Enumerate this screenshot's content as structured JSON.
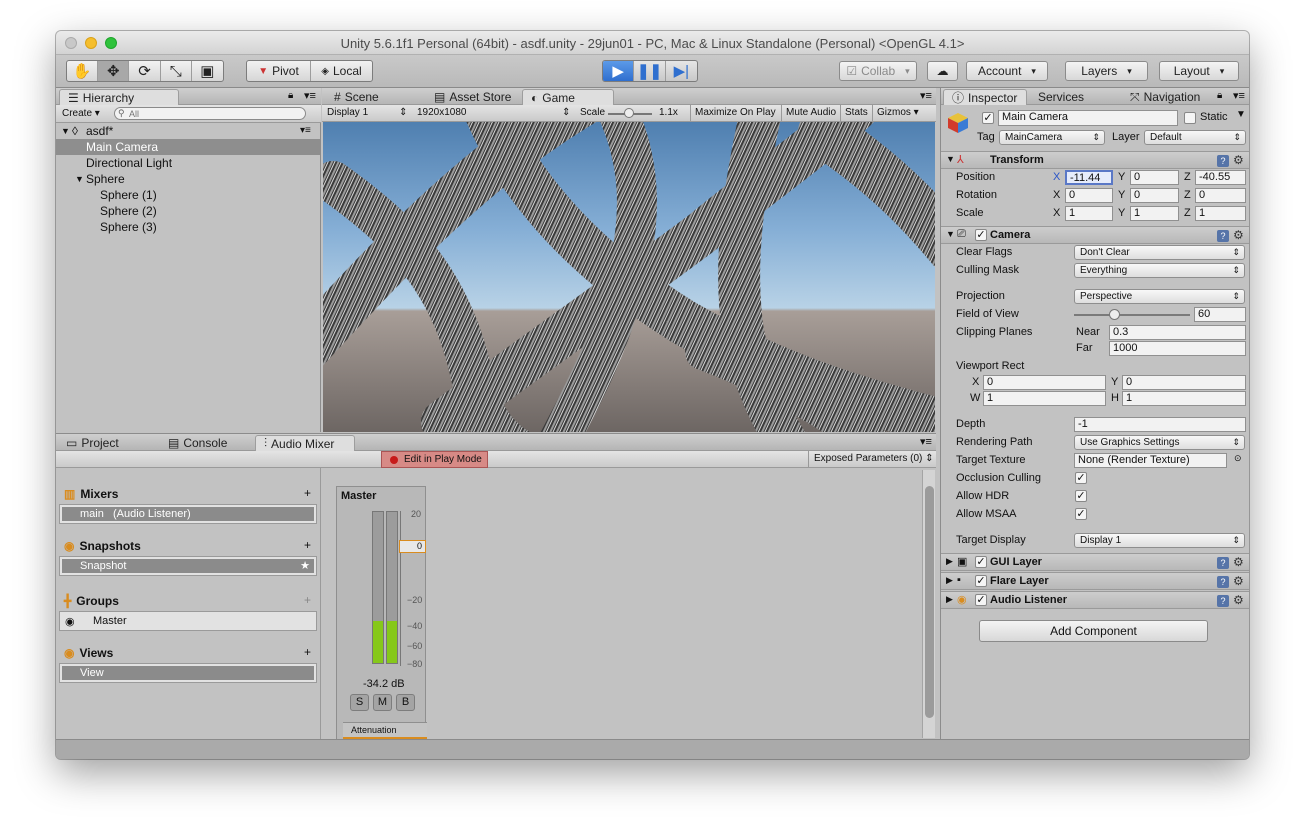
{
  "window": {
    "title": "Unity 5.6.1f1 Personal (64bit) - asdf.unity - 29jun01 - PC, Mac & Linux Standalone (Personal) <OpenGL 4.1>"
  },
  "toolbar": {
    "pivot": "Pivot",
    "local": "Local",
    "collab": "Collab",
    "account": "Account",
    "layers": "Layers",
    "layout": "Layout"
  },
  "hierarchy": {
    "tab": "Hierarchy",
    "create": "Create",
    "search_placeholder": "All",
    "scene": "asdf*",
    "items": [
      "Main Camera",
      "Directional Light",
      "Sphere",
      "Sphere (1)",
      "Sphere (2)",
      "Sphere (3)"
    ]
  },
  "center_tabs": {
    "scene": "Scene",
    "asset_store": "Asset Store",
    "game": "Game"
  },
  "game_bar": {
    "display": "Display 1",
    "resolution": "1920x1080",
    "scale_label": "Scale",
    "scale_value": "1.1x",
    "maximize": "Maximize On Play",
    "mute": "Mute Audio",
    "stats": "Stats",
    "gizmos": "Gizmos"
  },
  "bottom_tabs": {
    "project": "Project",
    "console": "Console",
    "audio_mixer": "Audio Mixer"
  },
  "mixer": {
    "edit_play": "Edit in Play Mode",
    "exposed": "Exposed Parameters (0)",
    "mixers_title": "Mixers",
    "mixer_item": "main",
    "mixer_item_sub": "(Audio Listener)",
    "snapshots_title": "Snapshots",
    "snapshot_item": "Snapshot",
    "groups_title": "Groups",
    "group_item": "Master",
    "views_title": "Views",
    "view_item": "View",
    "strip_title": "Master",
    "db_labels": [
      "20",
      "0",
      "−20",
      "−40",
      "−60",
      "−80"
    ],
    "fader_value": "0",
    "level_db": "-34.2 dB",
    "meter_level": 0.28,
    "btn_s": "S",
    "btn_m": "M",
    "btn_b": "B",
    "attenuation": "Attenuation"
  },
  "inspector": {
    "tab": "Inspector",
    "services": "Services",
    "navigation": "Navigation",
    "object_name": "Main Camera",
    "static": "Static",
    "tag_label": "Tag",
    "tag_value": "MainCamera",
    "layer_label": "Layer",
    "layer_value": "Default",
    "transform": {
      "title": "Transform",
      "position": "Position",
      "rotation": "Rotation",
      "scale": "Scale",
      "pos": [
        "-11.44",
        "0",
        "-40.55"
      ],
      "rot": [
        "0",
        "0",
        "0"
      ],
      "scl": [
        "1",
        "1",
        "1"
      ]
    },
    "camera": {
      "title": "Camera",
      "clear_flags": "Clear Flags",
      "clear_flags_v": "Don't Clear",
      "culling_mask": "Culling Mask",
      "culling_mask_v": "Everything",
      "projection": "Projection",
      "projection_v": "Perspective",
      "fov": "Field of View",
      "fov_v": "60",
      "clipping": "Clipping Planes",
      "near": "Near",
      "near_v": "0.3",
      "far": "Far",
      "far_v": "1000",
      "viewport": "Viewport Rect",
      "vx": "0",
      "vy": "0",
      "vw": "1",
      "vh": "1",
      "depth": "Depth",
      "depth_v": "-1",
      "rendering_path": "Rendering Path",
      "rendering_path_v": "Use Graphics Settings",
      "target_texture": "Target Texture",
      "target_texture_v": "None (Render Texture)",
      "occlusion": "Occlusion Culling",
      "hdr": "Allow HDR",
      "msaa": "Allow MSAA",
      "target_display": "Target Display",
      "target_display_v": "Display 1"
    },
    "gui_layer": "GUI Layer",
    "flare_layer": "Flare Layer",
    "audio_listener": "Audio Listener",
    "add_component": "Add Component"
  },
  "colors": {
    "play_blue": "#3b7ad9",
    "meter_green": "#86c81a",
    "selection": "#8e8e8e",
    "accent_orange": "#e0a030"
  }
}
